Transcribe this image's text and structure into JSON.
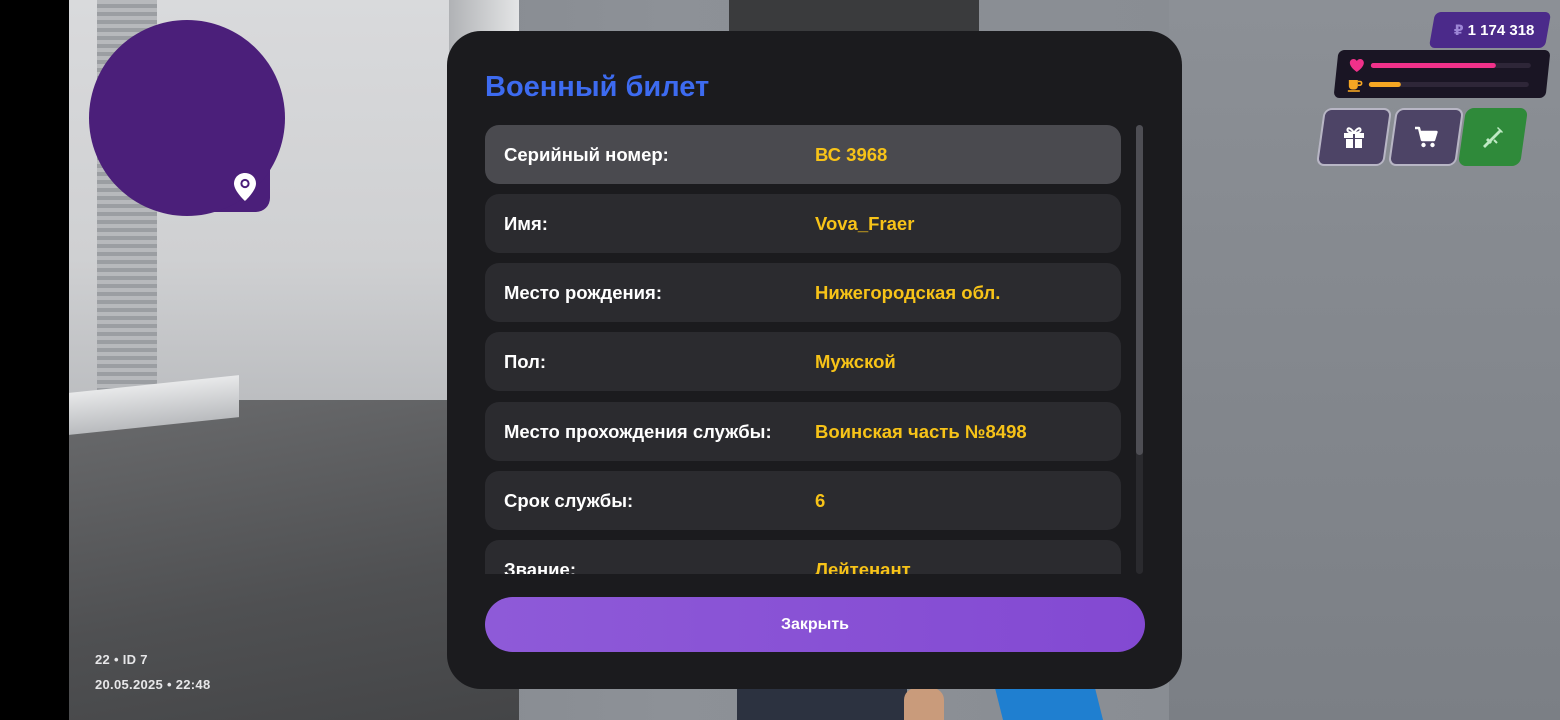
{
  "hud": {
    "money": "1 174 318",
    "currency_symbol": "₽",
    "health_level": 0.78,
    "hunger_level": 0.2,
    "colors": {
      "health": "#f0318a",
      "hunger": "#f5a623",
      "accent": "#4b2a8a"
    }
  },
  "minimap": {
    "icon": "location-pin-icon",
    "color": "#4b1f7a"
  },
  "player_info": {
    "line1": "22 • ID 7",
    "line2": "20.05.2025 • 22:48"
  },
  "dialog": {
    "title": "Военный билет",
    "rows": [
      {
        "label": "Серийный номер:",
        "value": "ВС 3968"
      },
      {
        "label": "Имя:",
        "value": "Vova_Fraer"
      },
      {
        "label": "Место рождения:",
        "value": "Нижегородская обл."
      },
      {
        "label": "Пол:",
        "value": "Мужской"
      },
      {
        "label": "Место прохождения службы:",
        "value": "Воинская часть №8498"
      },
      {
        "label": "Срок службы:",
        "value": "6"
      },
      {
        "label": "Звание:",
        "value": "Лейтенант"
      }
    ],
    "close_label": "Закрыть",
    "colors": {
      "title": "#3d6bf0",
      "value": "#f7c318",
      "button": "#8a52d6"
    }
  }
}
